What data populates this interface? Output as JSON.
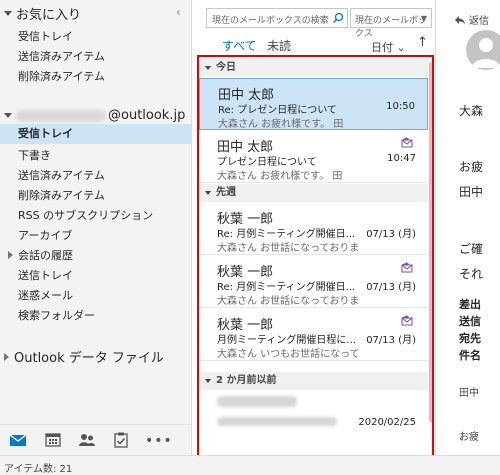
{
  "favorites": {
    "header": "お気に入り",
    "items": [
      "受信トレイ",
      "送信済みアイテム",
      "削除済みアイテム"
    ]
  },
  "account": {
    "email_suffix": "@outlook.jp",
    "folders": [
      "受信トレイ",
      "下書き",
      "送信済みアイテム",
      "削除済みアイテム",
      "RSS のサブスクリプション",
      "アーカイブ"
    ],
    "conversation_history": "会話の履歴",
    "folders_after": [
      "送信トレイ",
      "迷惑メール",
      "検索フォルダー"
    ]
  },
  "outlook_data_file": "Outlook データ ファイル",
  "toolbar": {
    "search_placeholder": "現在のメールボックスの検索",
    "scope_label": "現在のメールボックス",
    "tab_all": "すべて",
    "tab_unread": "未読",
    "sort_label": "日付",
    "sort_direction": "↑"
  },
  "groups": [
    {
      "label": "今日"
    },
    {
      "label": "先週"
    },
    {
      "label": "2 か月前以前"
    }
  ],
  "messages": [
    {
      "sender": "田中 太郎",
      "subject": "Re: プレゼン日程について",
      "preview": "大森さん  お疲れ様です。 田",
      "time": "10:50",
      "selected": true
    },
    {
      "sender": "田中 太郎",
      "subject": "プレゼン日程について",
      "preview": "大森さん  お疲れ様です。 田",
      "time": "10:47",
      "replied": true
    },
    {
      "sender": "秋葉 一郎",
      "subject": "Re: 月例ミーティング開催日...",
      "preview": "大森さん  お世話になっておりま",
      "time": "07/13 (月)"
    },
    {
      "sender": "秋葉 一郎",
      "subject": "Re: 月例ミーティング開催日...",
      "preview": "大森さん  お世話になっておりま",
      "time": "07/13 (月)",
      "replied": true
    },
    {
      "sender": "秋葉 一郎",
      "subject": "月例ミーティング開催日程に...",
      "preview": "大森さん  いつもお世話になって",
      "time": "07/13 (月)",
      "replied": true
    },
    {
      "sender": "",
      "subject": "",
      "preview": "",
      "time": "2020/02/25",
      "blurred": true
    }
  ],
  "reading": {
    "reply_label": "返信",
    "to_fragment": "大森",
    "greeting": "お疲",
    "sender_fragment": "田中",
    "body1": "ご確",
    "body2": "それ",
    "bold1": "差出",
    "bold2": "送信",
    "bold3": "宛先",
    "bold4": "件名",
    "sig": "田中",
    "closing": "お疲"
  },
  "status": {
    "item_count": "アイテム数: 21"
  },
  "colors": {
    "accent": "#0078d7",
    "selection": "#cde4f7",
    "highlight_frame": "#e60000"
  }
}
